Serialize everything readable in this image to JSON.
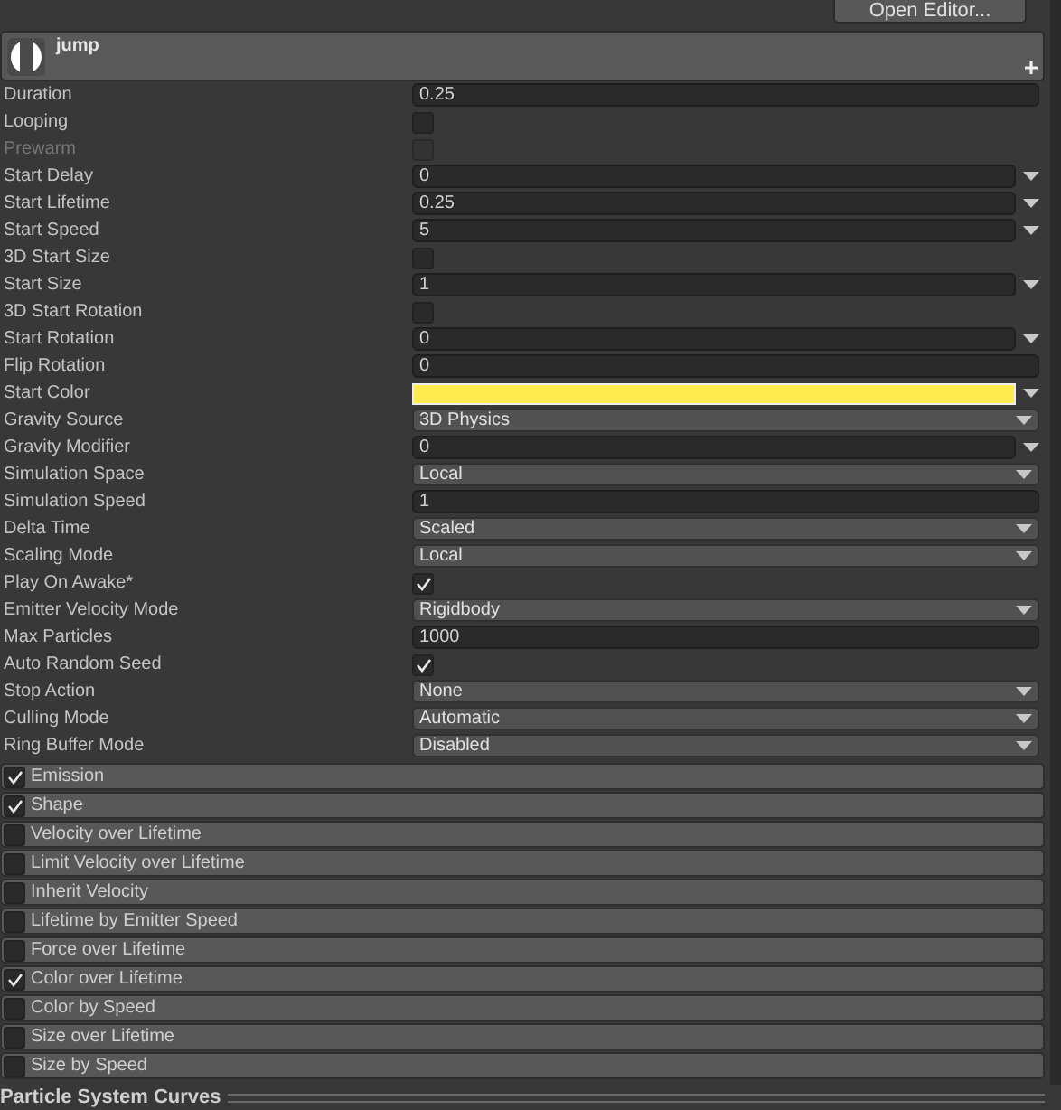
{
  "toolbar": {
    "open_editor": "Open Editor..."
  },
  "header": {
    "title": "jump"
  },
  "properties": [
    {
      "label": "Duration",
      "kind": "field",
      "value": "0.25"
    },
    {
      "label": "Looping",
      "kind": "check",
      "checked": false
    },
    {
      "label": "Prewarm",
      "kind": "check",
      "checked": false,
      "disabled": true
    },
    {
      "label": "Start Delay",
      "kind": "curve",
      "value": "0"
    },
    {
      "label": "Start Lifetime",
      "kind": "curve",
      "value": "0.25"
    },
    {
      "label": "Start Speed",
      "kind": "curve",
      "value": "5"
    },
    {
      "label": "3D Start Size",
      "kind": "check",
      "checked": false
    },
    {
      "label": "Start Size",
      "kind": "curve",
      "value": "1"
    },
    {
      "label": "3D Start Rotation",
      "kind": "check",
      "checked": false
    },
    {
      "label": "Start Rotation",
      "kind": "curve",
      "value": "0"
    },
    {
      "label": "Flip Rotation",
      "kind": "field",
      "value": "0"
    },
    {
      "label": "Start Color",
      "kind": "color",
      "color": "#ffeb4d"
    },
    {
      "label": "Gravity Source",
      "kind": "dropdown",
      "value": "3D Physics"
    },
    {
      "label": "Gravity Modifier",
      "kind": "curve",
      "value": "0"
    },
    {
      "label": "Simulation Space",
      "kind": "dropdown",
      "value": "Local"
    },
    {
      "label": "Simulation Speed",
      "kind": "field",
      "value": "1"
    },
    {
      "label": "Delta Time",
      "kind": "dropdown",
      "value": "Scaled"
    },
    {
      "label": "Scaling Mode",
      "kind": "dropdown",
      "value": "Local"
    },
    {
      "label": "Play On Awake*",
      "kind": "check",
      "checked": true
    },
    {
      "label": "Emitter Velocity Mode",
      "kind": "dropdown",
      "value": "Rigidbody"
    },
    {
      "label": "Max Particles",
      "kind": "field",
      "value": "1000"
    },
    {
      "label": "Auto Random Seed",
      "kind": "check",
      "checked": true
    },
    {
      "label": "Stop Action",
      "kind": "dropdown",
      "value": "None"
    },
    {
      "label": "Culling Mode",
      "kind": "dropdown",
      "value": "Automatic"
    },
    {
      "label": "Ring Buffer Mode",
      "kind": "dropdown",
      "value": "Disabled"
    }
  ],
  "modules": [
    {
      "label": "Emission",
      "checked": true
    },
    {
      "label": "Shape",
      "checked": true
    },
    {
      "label": "Velocity over Lifetime",
      "checked": false
    },
    {
      "label": "Limit Velocity over Lifetime",
      "checked": false
    },
    {
      "label": "Inherit Velocity",
      "checked": false
    },
    {
      "label": "Lifetime by Emitter Speed",
      "checked": false
    },
    {
      "label": "Force over Lifetime",
      "checked": false
    },
    {
      "label": "Color over Lifetime",
      "checked": true
    },
    {
      "label": "Color by Speed",
      "checked": false
    },
    {
      "label": "Size over Lifetime",
      "checked": false
    },
    {
      "label": "Size by Speed",
      "checked": false
    }
  ],
  "curves_panel": {
    "title": "Particle System Curves"
  }
}
